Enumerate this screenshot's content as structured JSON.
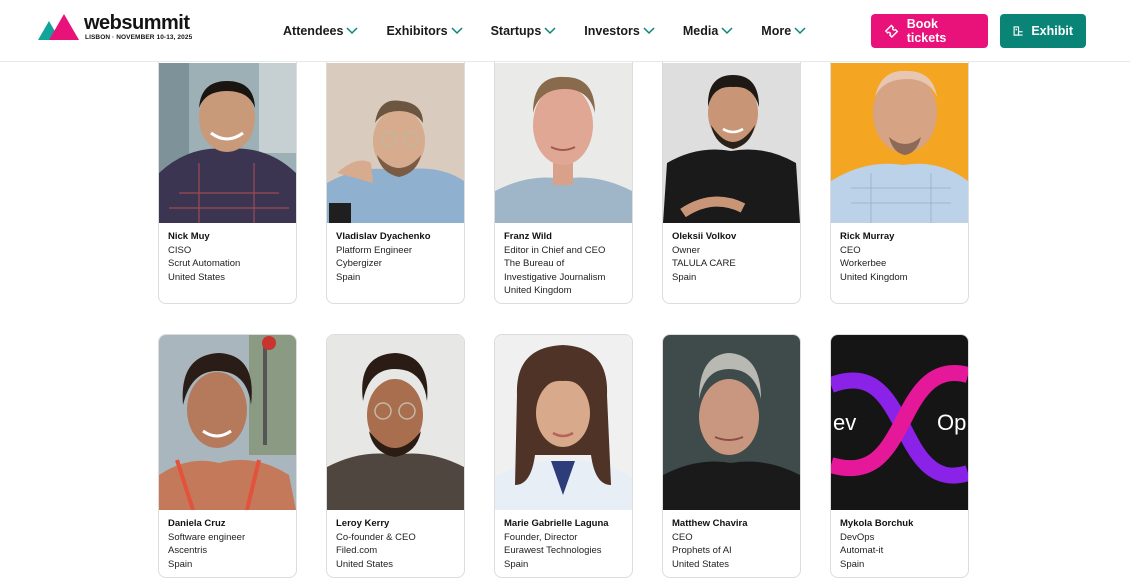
{
  "brand": {
    "wordmark": "websummit",
    "tagline": "LISBON · NOVEMBER 10-13, 2025",
    "colors": {
      "pink": "#e8127a",
      "teal": "#0b8478"
    }
  },
  "nav": [
    {
      "label": "Attendees"
    },
    {
      "label": "Exhibitors"
    },
    {
      "label": "Startups"
    },
    {
      "label": "Investors"
    },
    {
      "label": "Media"
    },
    {
      "label": "More"
    }
  ],
  "actions": {
    "book_tickets": "Book tickets",
    "exhibit": "Exhibit"
  },
  "speakers": [
    {
      "name": "Nick Muy",
      "lines": [
        "CISO",
        "Scrut Automation",
        "United States"
      ]
    },
    {
      "name": "Vladislav Dyachenko",
      "lines": [
        "Platform Engineer",
        "Cybergizer",
        "Spain"
      ]
    },
    {
      "name": "Franz Wild",
      "lines": [
        "Editor in Chief and CEO",
        "The Bureau of",
        "Investigative Journalism",
        "United Kingdom"
      ]
    },
    {
      "name": "Oleksii Volkov",
      "lines": [
        "Owner",
        "TALULA CARE",
        "Spain"
      ]
    },
    {
      "name": "Rick Murray",
      "lines": [
        "CEO",
        "Workerbee",
        "United Kingdom"
      ]
    },
    {
      "name": "Daniela Cruz",
      "lines": [
        "Software engineer",
        "Ascentris",
        "Spain"
      ]
    },
    {
      "name": "Leroy Kerry",
      "lines": [
        "Co-founder & CEO",
        "Filed.com",
        "United States"
      ]
    },
    {
      "name": "Marie Gabrielle Laguna",
      "lines": [
        "Founder, Director",
        "Eurawest Technologies",
        "Spain"
      ]
    },
    {
      "name": "Matthew Chavira",
      "lines": [
        "CEO",
        "Prophets of AI",
        "United States"
      ]
    },
    {
      "name": "Mykola Borchuk",
      "lines": [
        "DevOps",
        "Automat-it",
        "Spain"
      ]
    }
  ],
  "devops_logo": {
    "left": "ev",
    "right": "Op"
  }
}
